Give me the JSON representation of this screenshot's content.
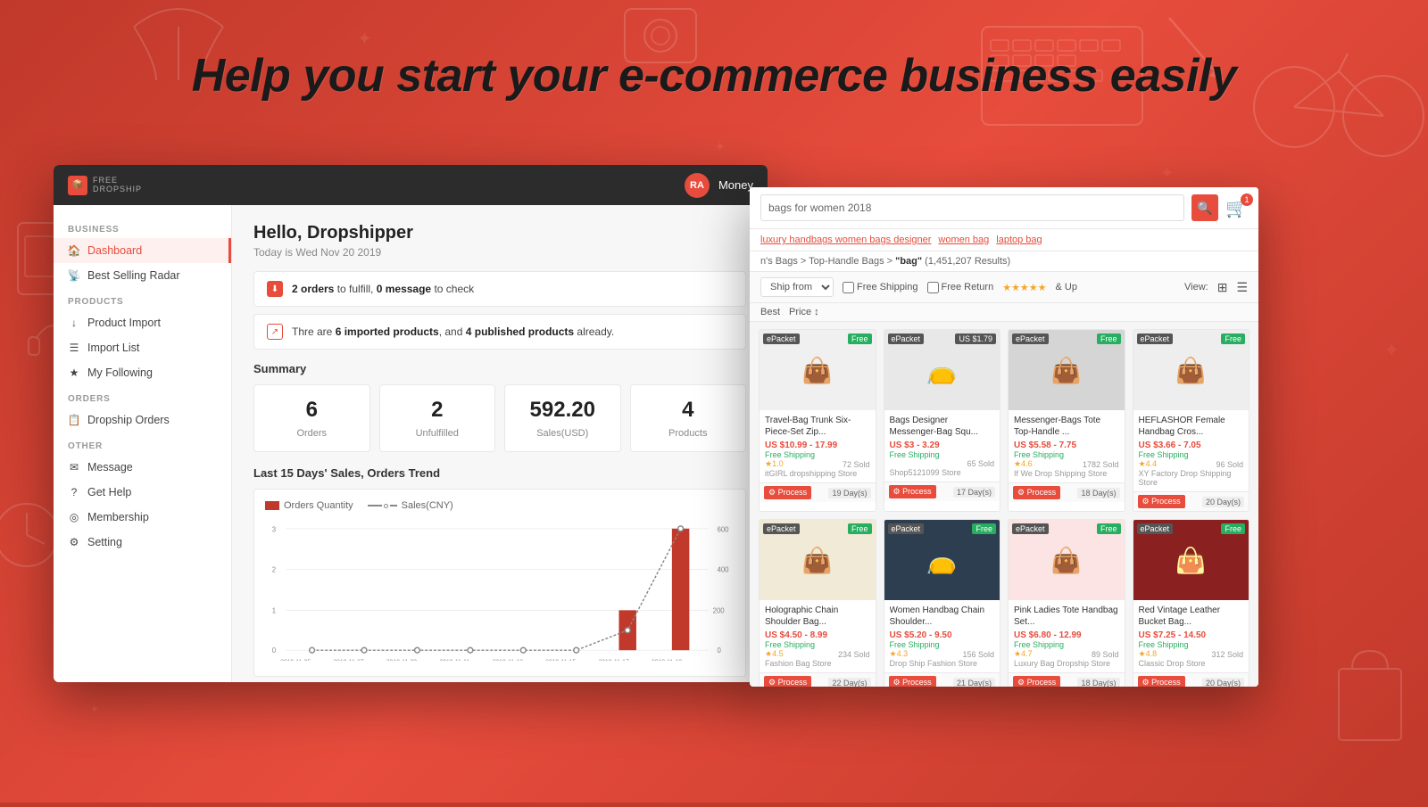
{
  "background": {
    "color": "#c0392b"
  },
  "headline": "Help you start your e-commerce business easily",
  "dashboard": {
    "logo": {
      "line1": "FREE",
      "line2": "DROPSHIP"
    },
    "header": {
      "avatar_initials": "RA",
      "money_label": "Money"
    },
    "sidebar": {
      "business_label": "BUSINESS",
      "items_business": [
        {
          "label": "Dashboard",
          "active": true,
          "icon": "🏠"
        },
        {
          "label": "Best Selling Radar",
          "active": false,
          "icon": "📡"
        }
      ],
      "products_label": "PRODUCTS",
      "items_products": [
        {
          "label": "Product Import",
          "active": false,
          "icon": "📦"
        },
        {
          "label": "Import List",
          "active": false,
          "icon": "☰"
        },
        {
          "label": "My Following",
          "active": false,
          "icon": "⭐"
        }
      ],
      "orders_label": "ORDERS",
      "items_orders": [
        {
          "label": "Dropship Orders",
          "active": false,
          "icon": "📋"
        }
      ],
      "other_label": "OTHER",
      "items_other": [
        {
          "label": "Message",
          "active": false,
          "icon": "✉️"
        },
        {
          "label": "Get Help",
          "active": false,
          "icon": "❓"
        },
        {
          "label": "Membership",
          "active": false,
          "icon": "👑"
        },
        {
          "label": "Setting",
          "active": false,
          "icon": "⚙️"
        }
      ]
    },
    "main": {
      "greeting": "Hello, Dropshipper",
      "date": "Today is Wed Nov 20 2019",
      "alerts": [
        {
          "type": "order",
          "text_parts": [
            "2 orders",
            " to fulfill, ",
            "0 message",
            " to check"
          ],
          "bold_indices": [
            0,
            2
          ]
        },
        {
          "type": "product",
          "text_parts": [
            "Thre are ",
            "6 imported products",
            ", and ",
            "4 published products",
            " already."
          ],
          "bold_indices": [
            1,
            3
          ]
        }
      ],
      "summary_title": "Summary",
      "summary_cards": [
        {
          "value": "6",
          "label": "Orders"
        },
        {
          "value": "2",
          "label": "Unfulfilled"
        },
        {
          "value": "592.20",
          "label": "Sales(USD)"
        },
        {
          "value": "4",
          "label": "Products"
        }
      ],
      "chart_title": "Last 15 Days' Sales, Orders Trend",
      "chart_legend": [
        {
          "label": "Orders Quantity",
          "color": "#c0392b",
          "type": "bar"
        },
        {
          "label": "Sales(CNY)",
          "color": "#888",
          "type": "line"
        }
      ],
      "chart_dates": [
        "2019-11-05",
        "2019-11-07",
        "2019-11-09",
        "2019-11-11",
        "2019-11-13",
        "2019-11-15",
        "2019-11-17",
        "2019-11-19"
      ],
      "chart_orders": [
        0,
        0,
        0,
        0,
        0,
        0,
        1,
        3
      ],
      "chart_sales": [
        0,
        0,
        0,
        0,
        0,
        0,
        100,
        600
      ]
    }
  },
  "product_window": {
    "search_placeholder": "bags for women 2018",
    "search_tags": [
      "luxury handbags women bags designer",
      "women bag",
      "laptop bag"
    ],
    "breadcrumb": "n's Bags > Top-Handle Bags > \"bag\" (1,451,207 Results)",
    "filters": {
      "ship_from": "Ship from",
      "options": [
        "Free Shipping",
        "Free Return"
      ],
      "stars_label": "& Up",
      "view_label": "View:"
    },
    "sort_options": [
      "Best",
      "Price ↕"
    ],
    "cart_count": 1,
    "products": [
      {
        "name": "Travel-Bag Trunk Six-Piece-Set Zip...",
        "price": "US $10.99 - 17.99",
        "shipping": "Free Shipping",
        "store": "itGIRL dropshipping Store",
        "badge": "ePacket",
        "badge_type": "free",
        "process_days": "19 Day(s)",
        "emoji": "👜",
        "emoji_class": "bag1",
        "stars": "★1.0",
        "sold": "72 Sold"
      },
      {
        "name": "Bags Designer Messenger-Bag Squ...",
        "price": "US $3 - 3.29",
        "shipping": "Free Shipping",
        "store": "Shop5121099 Store",
        "badge": "ePacket",
        "badge_type": "price",
        "badge_price": "US $1.79",
        "process_days": "17 Day(s)",
        "emoji": "👝",
        "emoji_class": "bag2",
        "stars": "",
        "sold": "65 Sold"
      },
      {
        "name": "Messenger-Bags Tote Top-Handle ...",
        "price": "US $5.58 - 7.75",
        "shipping": "Free Shipping",
        "store": "If We Drop Shipping Store",
        "badge": "ePacket",
        "badge_type": "free",
        "process_days": "18 Day(s)",
        "emoji": "👜",
        "emoji_class": "bag3",
        "stars": "★4.6",
        "sold": "1782 Sold"
      },
      {
        "name": "HEFLASHOR Female Handbag Cros...",
        "price": "US $3.66 - 7.05",
        "shipping": "Free Shipping",
        "store": "XY Factory Drop Shipping Store",
        "badge": "ePacket",
        "badge_type": "free",
        "process_days": "20 Day(s)",
        "emoji": "👜",
        "emoji_class": "bag4",
        "stars": "★4.4",
        "sold": "96 Sold"
      },
      {
        "name": "Holographic Chain Shoulder Bag...",
        "price": "US $4.50 - 8.99",
        "shipping": "Free Shipping",
        "store": "Fashion Bag Store",
        "badge": "ePacket",
        "badge_type": "free",
        "process_days": "22 Day(s)",
        "emoji": "👜",
        "emoji_class": "bag5",
        "stars": "★4.5",
        "sold": "234 Sold"
      },
      {
        "name": "Women Handbag Chain Shoulder...",
        "price": "US $5.20 - 9.50",
        "shipping": "Free Shipping",
        "store": "Drop Ship Fashion Store",
        "badge": "ePacket",
        "badge_type": "free",
        "process_days": "21 Day(s)",
        "emoji": "👝",
        "emoji_class": "bag6",
        "stars": "★4.3",
        "sold": "156 Sold"
      },
      {
        "name": "Pink Ladies Tote Handbag Set...",
        "price": "US $6.80 - 12.99",
        "shipping": "Free Shipping",
        "store": "Luxury Bag Dropship Store",
        "badge": "ePacket",
        "badge_type": "free",
        "process_days": "18 Day(s)",
        "emoji": "👜",
        "emoji_class": "bag7",
        "stars": "★4.7",
        "sold": "89 Sold"
      },
      {
        "name": "Red Vintage Leather Bucket Bag...",
        "price": "US $7.25 - 14.50",
        "shipping": "Free Shipping",
        "store": "Classic Drop Store",
        "badge": "ePacket",
        "badge_type": "free",
        "process_days": "20 Day(s)",
        "emoji": "👜",
        "emoji_class": "bag8",
        "stars": "★4.8",
        "sold": "312 Sold"
      }
    ]
  }
}
